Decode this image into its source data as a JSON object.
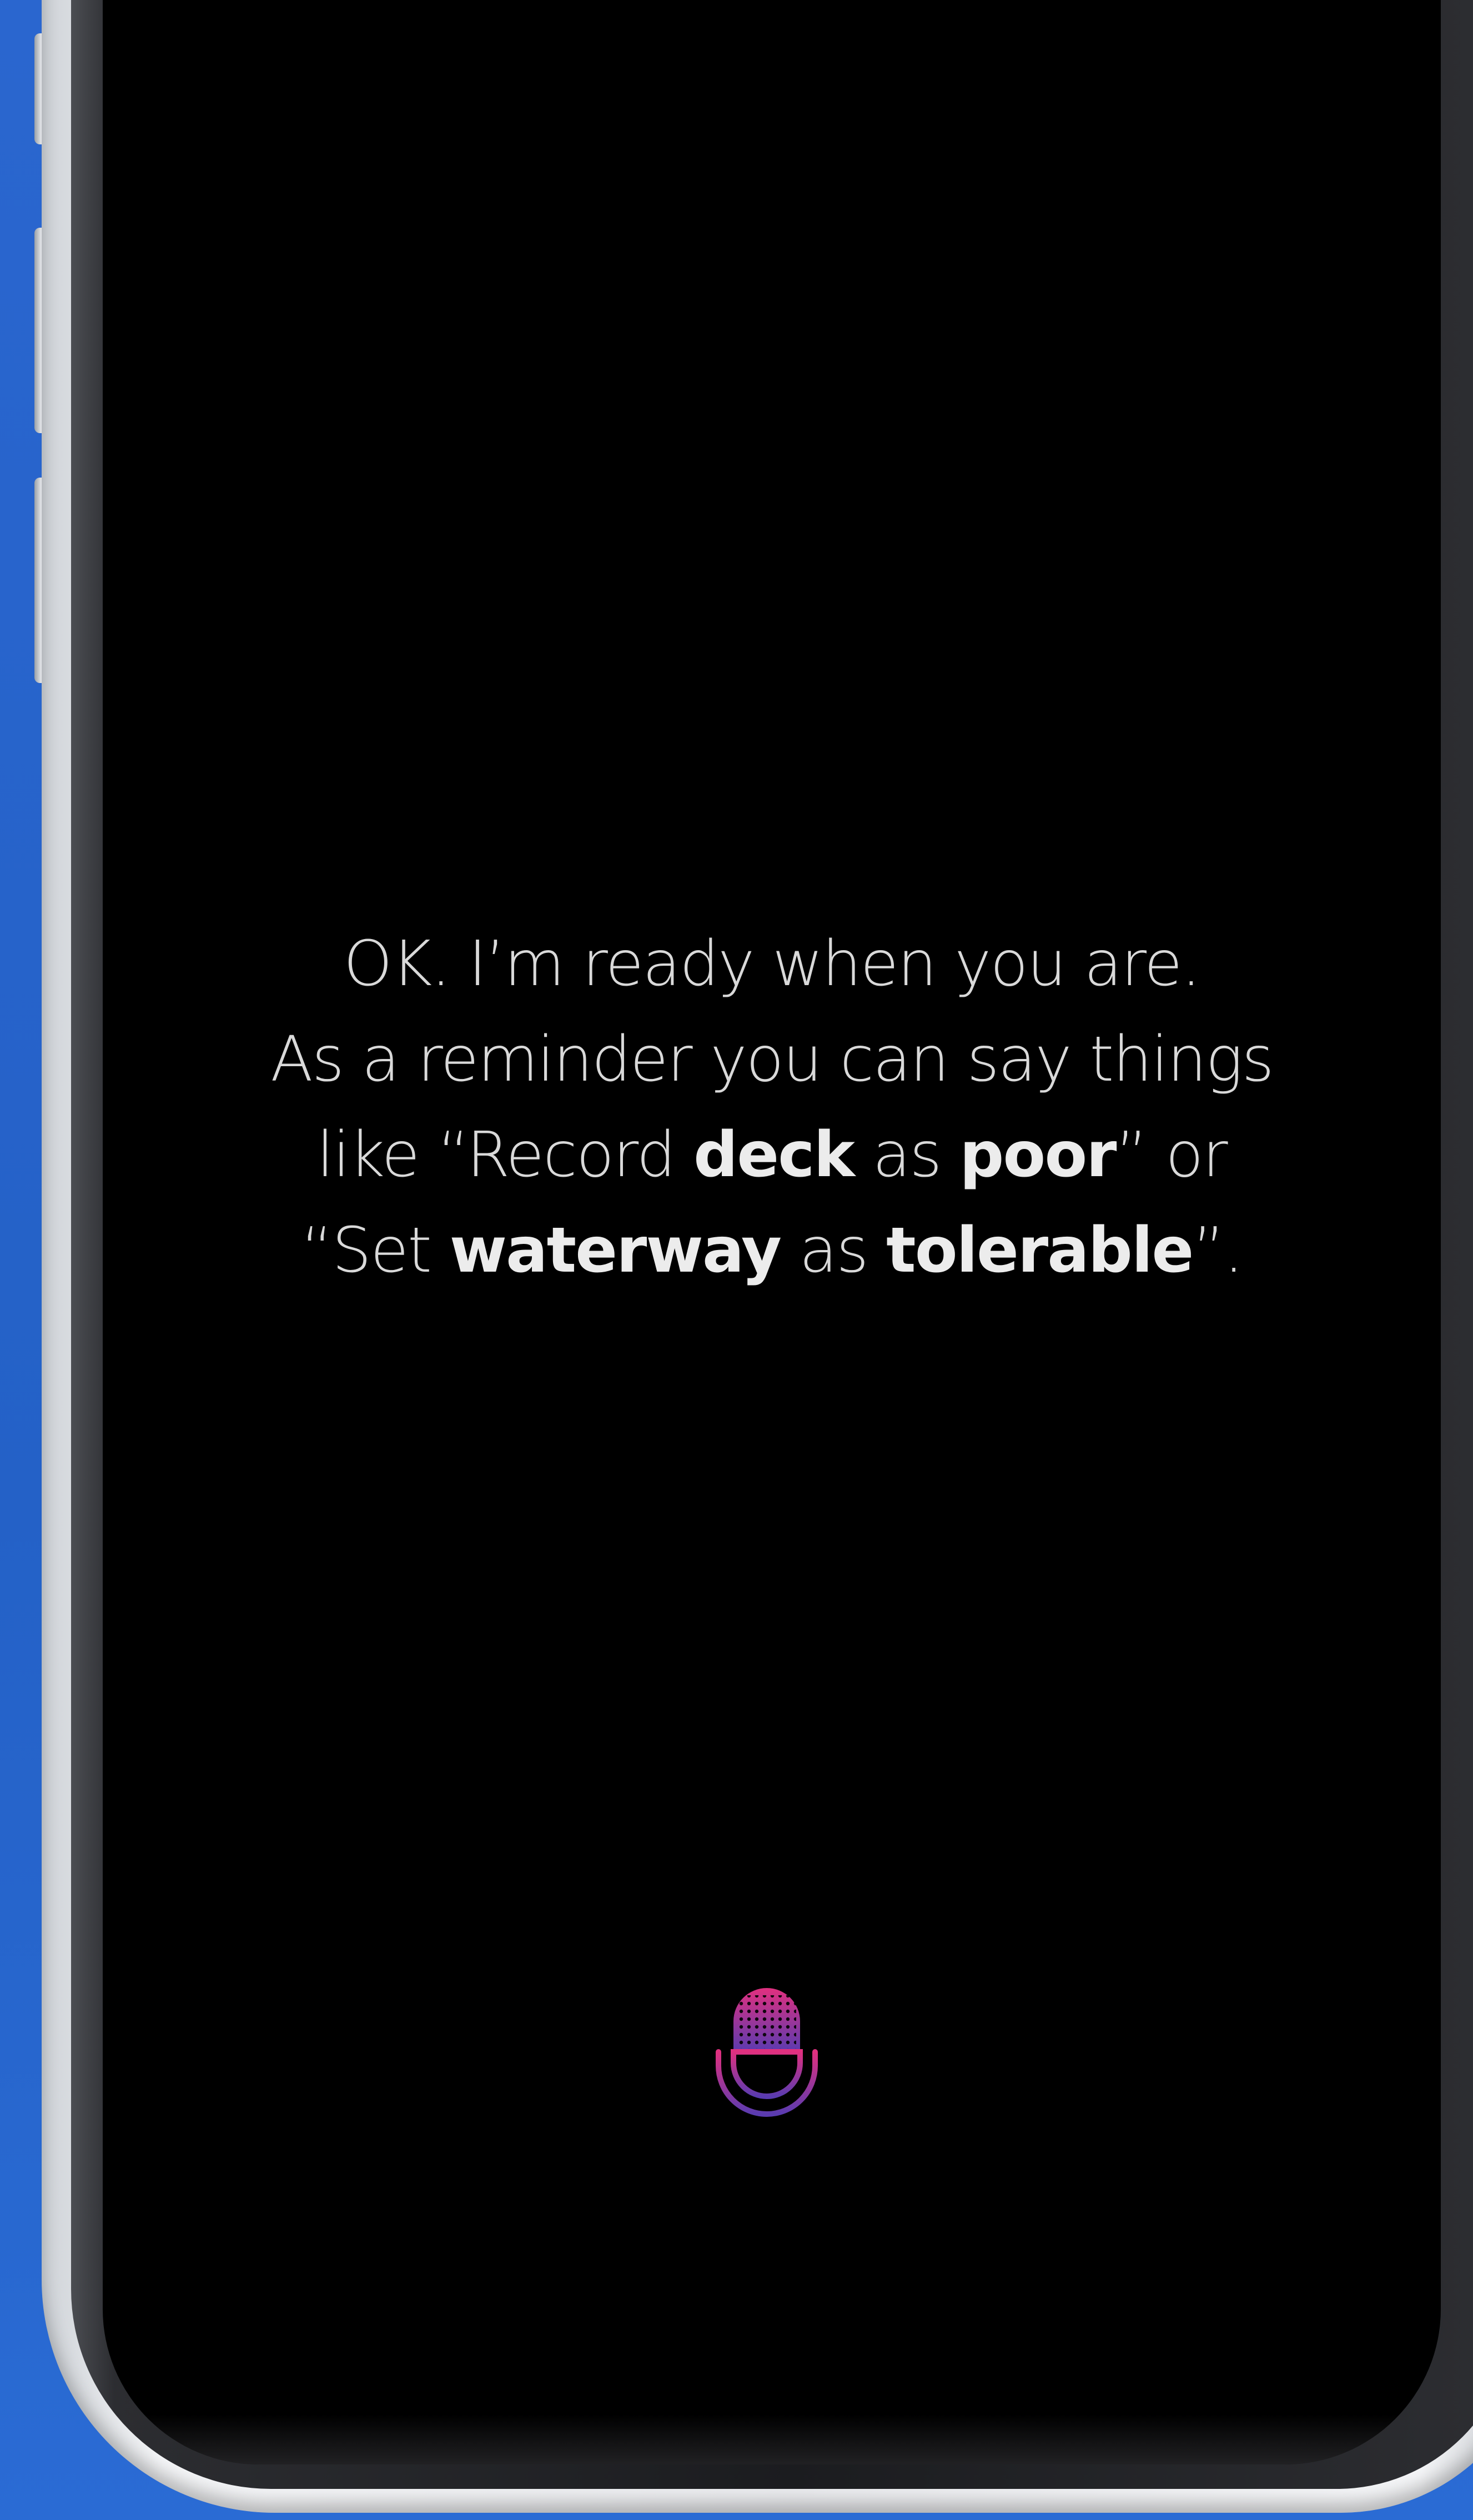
{
  "prompt": {
    "line1": "OK. I’m ready when you are.",
    "line2": "As a reminder you can say things",
    "line3_pre": "like “Record ",
    "line3_b1": "deck",
    "line3_mid": " as ",
    "line3_b2": "poor",
    "line3_post": "” or",
    "line4_pre": "“Set ",
    "line4_b1": "waterway",
    "line4_mid": " as ",
    "line4_b2": "tolerable",
    "line4_post": "”."
  },
  "microphone": {
    "icon": "microphone-icon",
    "gradient_top": "#e0307f",
    "gradient_bottom": "#5a3bb0"
  },
  "colors": {
    "background": "#2563c9",
    "screen": "#000000",
    "text": "#d9d9d9"
  }
}
